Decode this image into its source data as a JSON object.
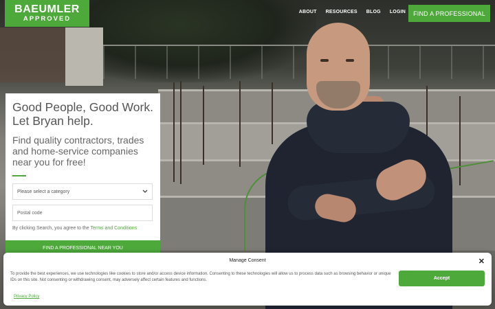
{
  "logo": {
    "top": "BAEUMLER",
    "bottom": "APPROVED"
  },
  "nav": {
    "about": "ABOUT",
    "resources": "RESOURCES",
    "blog": "BLOG",
    "login": "LOGIN"
  },
  "header": {
    "cta": "FIND A PROFESSIONAL"
  },
  "card": {
    "headline": "Good People, Good Work. Let Bryan help.",
    "subhead": "Find quality contractors, trades and home-service companies near you for free!",
    "category_select": "Please select a category",
    "postal_placeholder": "Postal code",
    "terms_prefix": "By clicking Search, you agree to the",
    "terms_link": "Terms and Conditions",
    "search_button": "FIND A PROFESSIONAL NEAR YOU"
  },
  "consent": {
    "title": "Manage Consent",
    "text": "To provide the best experiences, we use technologies like cookies to store and/or access device information. Consenting to these technologies will allow us to process data such as browsing behavior or unique IDs on this site. Not consenting or withdrawing consent, may adversely affect certain features and functions.",
    "accept": "Accept",
    "privacy": "Privacy Policy"
  },
  "colors": {
    "brand_green": "#4ea93b"
  },
  "icons": {
    "close": "close-icon",
    "dropdown": "chevron-down-icon"
  }
}
